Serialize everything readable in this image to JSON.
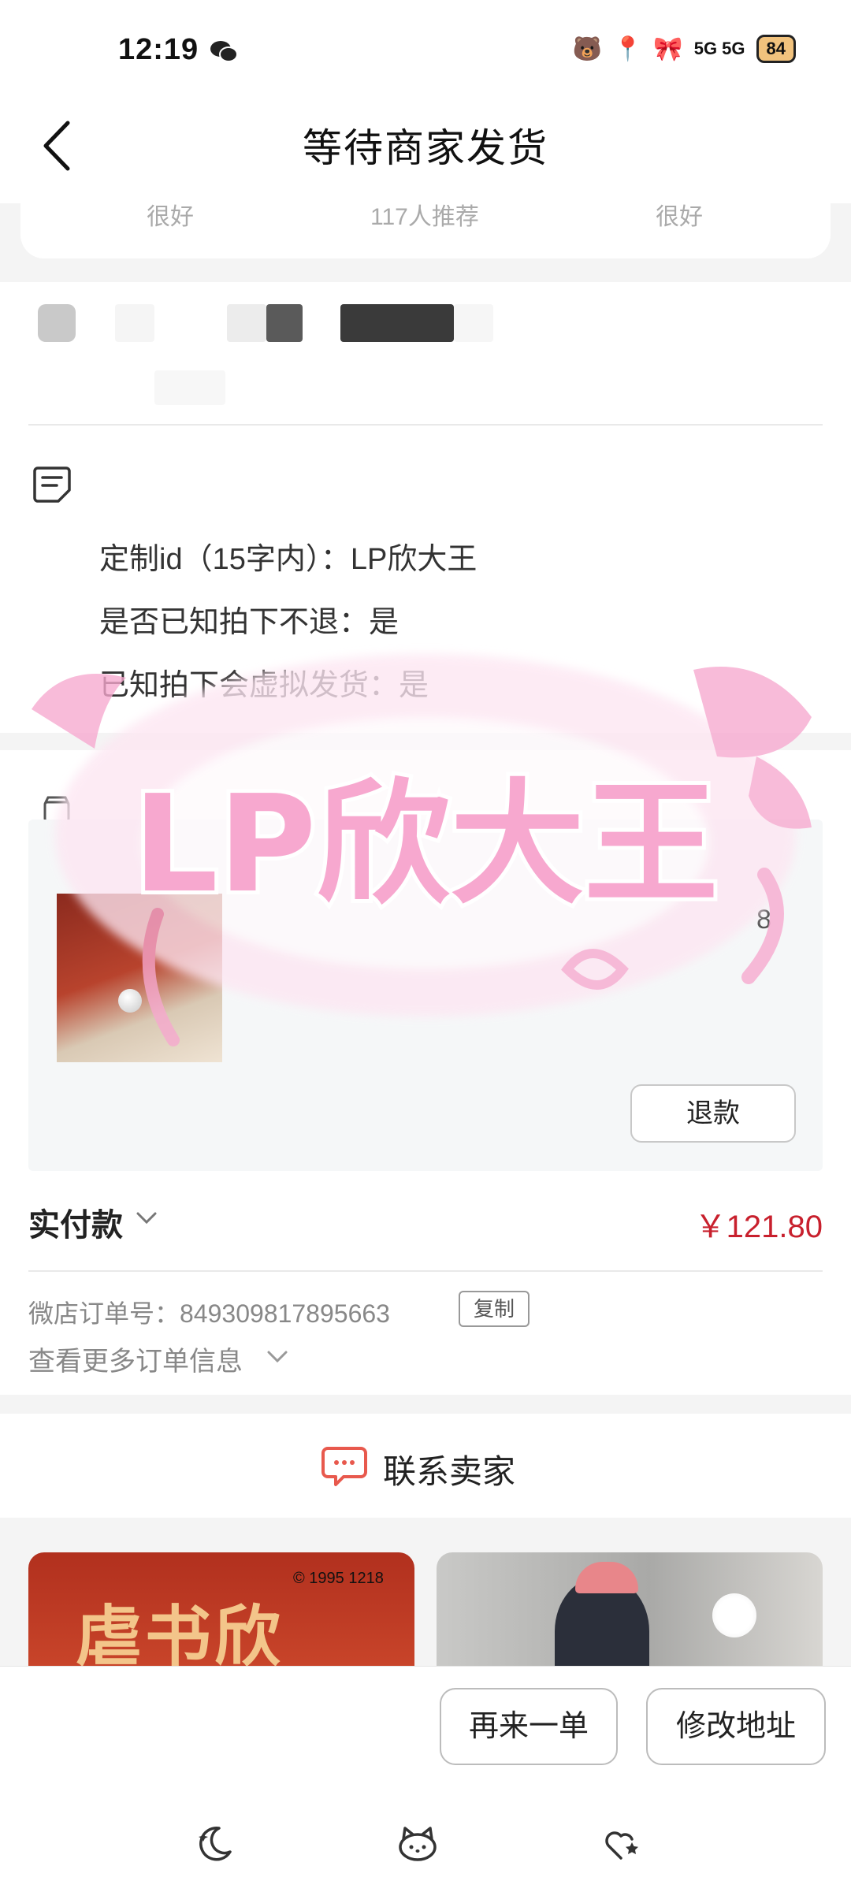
{
  "status_bar": {
    "time": "12:19",
    "indicators": "5G 5G",
    "battery": "84"
  },
  "header": {
    "title": "等待商家发货"
  },
  "ratings": [
    "很好",
    "117人推荐",
    "很好"
  ],
  "custom_info": [
    "定制id（15字内）：LP欣大王",
    "是否已知拍下不退：是",
    "已知拍下会虚拟发货：是"
  ],
  "product": {
    "quantity": "8",
    "refund_label": "退款"
  },
  "payment": {
    "label": "实付款",
    "amount": "￥121.80"
  },
  "order": {
    "number_label": "微店订单号：849309817895663",
    "copy_label": "复制",
    "more_label": "查看更多订单信息"
  },
  "contact": {
    "label": "联系卖家"
  },
  "recommend": {
    "item1_title": "虐书欣",
    "item1_date": "© 1995 1218"
  },
  "actions": {
    "reorder_label": "再来一单",
    "change_address_label": "修改地址"
  },
  "sticker": {
    "text": "LP欣大王"
  },
  "colors": {
    "price_red": "#c8202d",
    "sticker_pink": "#f7a8cf",
    "contact_icon": "#e8594d"
  }
}
